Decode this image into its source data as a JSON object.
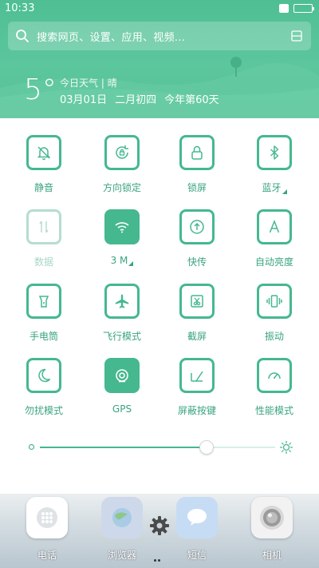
{
  "status_bar": {
    "time": "10:33"
  },
  "search": {
    "placeholder": "搜索网页、设置、应用、视频..."
  },
  "weather": {
    "temperature": "5°",
    "today_label": "今日天气",
    "separator": "|",
    "condition": "晴",
    "date": "03月01日",
    "lunar": "二月初四",
    "day_of_year": "今年第60天"
  },
  "toggles": [
    {
      "label": "静音",
      "icon": "bell-off-icon",
      "state": "off"
    },
    {
      "label": "方向锁定",
      "icon": "rotation-lock-icon",
      "state": "off"
    },
    {
      "label": "锁屏",
      "icon": "lock-icon",
      "state": "off"
    },
    {
      "label": "蓝牙",
      "icon": "bluetooth-icon",
      "state": "off",
      "has_more": true
    },
    {
      "label": "数据",
      "icon": "data-arrows-icon",
      "state": "disabled"
    },
    {
      "label": "3 M",
      "icon": "wifi-icon",
      "state": "on",
      "has_more": true
    },
    {
      "label": "快传",
      "icon": "upload-icon",
      "state": "off"
    },
    {
      "label": "自动亮度",
      "icon": "auto-brightness-icon",
      "state": "off"
    },
    {
      "label": "手电筒",
      "icon": "flashlight-icon",
      "state": "off"
    },
    {
      "label": "飞行模式",
      "icon": "airplane-icon",
      "state": "off"
    },
    {
      "label": "截屏",
      "icon": "screenshot-icon",
      "state": "off"
    },
    {
      "label": "振动",
      "icon": "vibrate-icon",
      "state": "off"
    },
    {
      "label": "勿扰模式",
      "icon": "moon-icon",
      "state": "off"
    },
    {
      "label": "GPS",
      "icon": "gps-icon",
      "state": "on"
    },
    {
      "label": "屏蔽按键",
      "icon": "block-keys-icon",
      "state": "off"
    },
    {
      "label": "性能模式",
      "icon": "speedometer-icon",
      "state": "off"
    }
  ],
  "brightness": {
    "level": 0.71
  },
  "dock": [
    {
      "label": "电话",
      "icon": "phone-dialpad-icon"
    },
    {
      "label": "浏览器",
      "icon": "browser-icon"
    },
    {
      "label": "短信",
      "icon": "messages-icon"
    },
    {
      "label": "相机",
      "icon": "camera-icon"
    }
  ],
  "colors": {
    "accent": "#45b88f",
    "header": "#56bf96",
    "dim": "#b5dece"
  }
}
